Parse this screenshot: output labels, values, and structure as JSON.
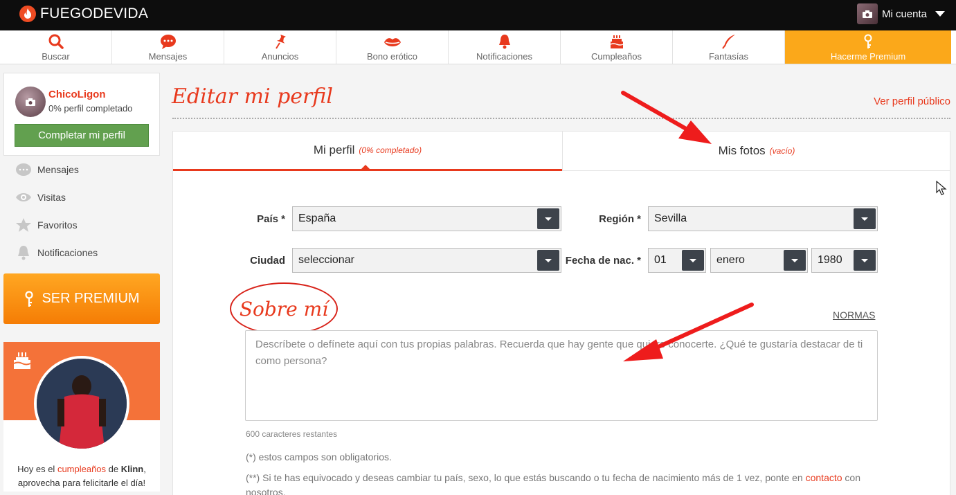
{
  "topbar": {
    "logo_text": "FUEGODEVIDA",
    "account_label": "Mi cuenta"
  },
  "nav": [
    {
      "label": "Buscar",
      "icon": "search-icon"
    },
    {
      "label": "Mensajes",
      "icon": "chat-bubble-icon"
    },
    {
      "label": "Anuncios",
      "icon": "pin-icon"
    },
    {
      "label": "Bono erótico",
      "icon": "lips-icon"
    },
    {
      "label": "Notificaciones",
      "icon": "bell-icon"
    },
    {
      "label": "Cumpleaños",
      "icon": "cake-icon"
    },
    {
      "label": "Fantasías",
      "icon": "feather-icon"
    },
    {
      "label": "Hacerme Premium",
      "icon": "key-icon"
    }
  ],
  "sidebar": {
    "username": "ChicoLigon",
    "profile_status": "0% perfil completado",
    "complete_button": "Completar mi perfil",
    "menu": [
      {
        "label": "Mensajes",
        "icon": "chat-icon"
      },
      {
        "label": "Visitas",
        "icon": "eye-icon"
      },
      {
        "label": "Favoritos",
        "icon": "star-icon"
      },
      {
        "label": "Notificaciones",
        "icon": "bell-icon"
      }
    ],
    "premium_button": "SER PREMIUM",
    "birthday": {
      "line1_prefix": "Hoy es el ",
      "line1_link": "cumpleaños",
      "line1_mid": " de ",
      "name": "Klinn",
      "line1_suffix": ",",
      "line2": "aprovecha para felicitarle el día!"
    }
  },
  "main": {
    "title": "Editar mi perfil",
    "public_link": "Ver perfil público",
    "tabs": [
      {
        "label": "Mi perfil",
        "sub": "(0% completado)"
      },
      {
        "label": "Mis fotos",
        "sub": "(vacío)"
      }
    ],
    "form": {
      "country_label": "País *",
      "country_value": "España",
      "region_label": "Región *",
      "region_value": "Sevilla",
      "city_label": "Ciudad",
      "city_value": "seleccionar",
      "birth_label": "Fecha de nac. *",
      "birth_day": "01",
      "birth_month": "enero",
      "birth_year": "1980"
    },
    "about_title": "Sobre mí",
    "rules_link": "NORMAS",
    "about_placeholder": "Descríbete o defínete aquí con tus propias palabras. Recuerda que hay gente que quiere conocerte. ¿Qué te gustaría destacar de ti como persona?",
    "chars_left": "600 caracteres restantes",
    "note_required": "(*) estos campos son obligatorios.",
    "note_change_prefix": "(**) Si te has equivocado y deseas cambiar tu país, sexo, lo que estás buscando o tu fecha de nacimiento más de 1 vez, ponte en ",
    "note_change_link": "contacto",
    "note_change_suffix": " con nosotros."
  },
  "colors": {
    "brand_red": "#e8391d",
    "premium_orange": "#fba81a",
    "complete_green": "#62a04f",
    "arrow_red": "#ee1c1c"
  }
}
